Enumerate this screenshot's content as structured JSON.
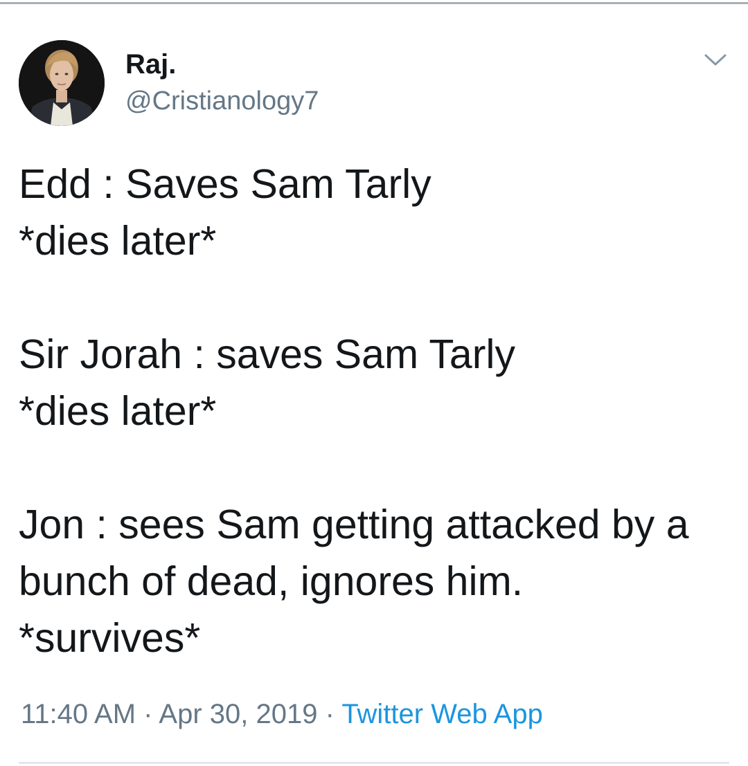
{
  "tweet": {
    "author": {
      "display_name": "Raj.",
      "handle": "@Cristianology7",
      "avatar_icon": "profile-photo"
    },
    "menu_icon": "chevron-down-icon",
    "lines": [
      "Edd : Saves Sam Tarly",
      "*dies later*",
      "",
      "Sir Jorah : saves Sam Tarly",
      "*dies later*",
      "",
      "Jon : sees Sam getting attacked by a",
      "bunch of dead, ignores him.",
      "*survives*"
    ],
    "meta": {
      "time": "11:40 AM",
      "separator": "·",
      "date": "Apr 30, 2019",
      "source": "Twitter Web App"
    }
  },
  "colors": {
    "text": "#14171a",
    "secondary_text": "#657786",
    "link": "#1b95e0",
    "divider": "#e1e8ed"
  }
}
